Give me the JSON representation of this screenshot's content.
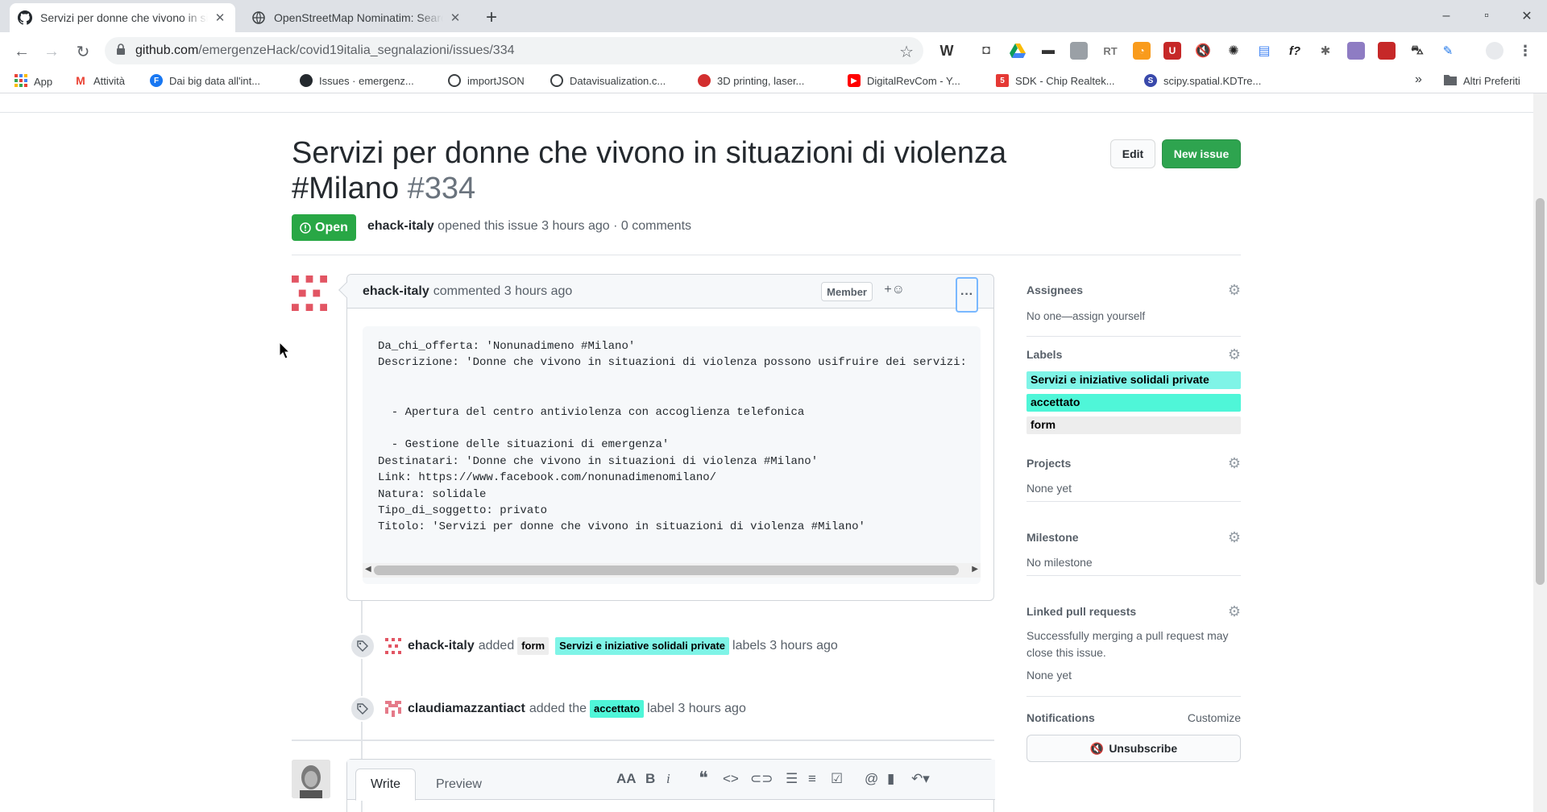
{
  "browser": {
    "tabs": [
      {
        "title": "Servizi per donne che vivono in situazioni"
      },
      {
        "title": "OpenStreetMap Nominatim: Search"
      }
    ],
    "url_host": "github.com",
    "url_path": "/emergenzeHack/covid19italia_segnalazioni/issues/334",
    "bookmarks": [
      {
        "label": "App"
      },
      {
        "label": "Attività"
      },
      {
        "label": "Dai big data all'int..."
      },
      {
        "label": "Issues · emergenz..."
      },
      {
        "label": "importJSON"
      },
      {
        "label": "Datavisualization.c..."
      },
      {
        "label": "3D printing, laser..."
      },
      {
        "label": "DigitalRevCom - Y..."
      },
      {
        "label": "SDK - Chip Realtek..."
      },
      {
        "label": "scipy.spatial.KDTre..."
      }
    ],
    "bookmarks_more": "»",
    "other_bookmarks": "Altri Preferiti"
  },
  "issue": {
    "title": "Servizi per donne che vivono in situazioni di violenza #Milano",
    "number": "#334",
    "edit_label": "Edit",
    "new_issue_label": "New issue",
    "state": "Open",
    "author": "ehack-italy",
    "meta_text": "opened this issue 3 hours ago · 0 comments"
  },
  "comment": {
    "author": "ehack-italy",
    "time": "commented 3 hours ago",
    "role_badge": "Member",
    "react": "+☺",
    "more": "···",
    "code": "Da_chi_offerta: 'Nonunadimeno #Milano'\nDescrizione: 'Donne che vivono in situazioni di violenza possono usifruire dei servizi:\n\n\n  - Apertura del centro antiviolenza con accoglienza telefonica\n\n  - Gestione delle situazioni di emergenza'\nDestinatari: 'Donne che vivono in situazioni di violenza #Milano'\nLink: https://www.facebook.com/nonunadimenomilano/\nNatura: solidale\nTipo_di_soggetto: privato\nTitolo: 'Servizi per donne che vivono in situazioni di violenza #Milano'"
  },
  "events": [
    {
      "actor": "ehack-italy",
      "verb": "added",
      "labels": [
        "form",
        "Servizi e iniziative solidali private"
      ],
      "suffix": "labels 3 hours ago"
    },
    {
      "actor": "claudiamazzantiact",
      "verb": "added the",
      "labels": [
        "accettato"
      ],
      "suffix": "label 3 hours ago"
    }
  ],
  "editor": {
    "write_tab": "Write",
    "preview_tab": "Preview"
  },
  "sidebar": {
    "assignees": {
      "title": "Assignees",
      "value": "No one—assign yourself"
    },
    "labels": {
      "title": "Labels",
      "items": [
        {
          "name": "Servizi e iniziative solidali private",
          "color": "#7ff4e7"
        },
        {
          "name": "accettato",
          "color": "#4ff6d8"
        },
        {
          "name": "form",
          "color": "#ededed"
        }
      ]
    },
    "projects": {
      "title": "Projects",
      "value": "None yet"
    },
    "milestone": {
      "title": "Milestone",
      "value": "No milestone"
    },
    "linked": {
      "title": "Linked pull requests",
      "value": "Successfully merging a pull request may close this issue.",
      "value2": "None yet"
    },
    "notifications": {
      "title": "Notifications",
      "customize": "Customize",
      "unsubscribe": "Unsubscribe"
    }
  },
  "colors": {
    "open_green": "#28a745",
    "new_issue_green": "#2ea44f"
  }
}
